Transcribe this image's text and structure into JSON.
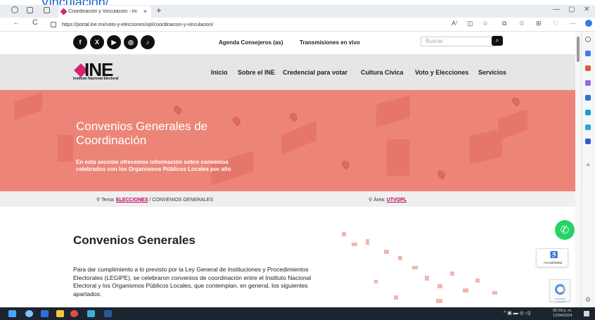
{
  "stray_link": "Vinculacion/",
  "browser": {
    "tab_title": "Coordinación y Vinculación - Inst",
    "tab_close": "×",
    "new_tab": "+",
    "url": "https://portal.ine.mx/voto-y-elecciones/opl/coordinacion-y-vinculacion/",
    "minimize": "—",
    "restore": "▢",
    "close": "✕",
    "back": "←",
    "reload": "C",
    "more": "···"
  },
  "site": {
    "socials": [
      {
        "icon": "facebook-icon",
        "glyph": "f"
      },
      {
        "icon": "x-twitter-icon",
        "glyph": "X"
      },
      {
        "icon": "youtube-icon",
        "glyph": "▶"
      },
      {
        "icon": "instagram-icon",
        "glyph": "◎"
      },
      {
        "icon": "tiktok-icon",
        "glyph": "♪"
      }
    ],
    "top_links": [
      "Agenda Consejeros (as)",
      "Transmisiones en vivo"
    ],
    "search_placeholder": "Buscar",
    "logo_text": "INE",
    "logo_sub": "Instituto Nacional Electoral",
    "nav": [
      "Inicio",
      "Sobre el INE",
      "Credencial para votar",
      "Cultura Cívica",
      "Voto y Elecciones",
      "Servicios"
    ]
  },
  "hero": {
    "title": "Convenios Generales de Coordinación",
    "description": "En esta sección ofrecemos información sobre convenios celebrados con los Organismos Públicos Locales por año"
  },
  "breadcrumb": {
    "tema_label": "Tema:",
    "tema_link": "ELECCIONES",
    "tema_rest": "/ CONVENIOS GENERALES",
    "area_label": "Área:",
    "area_link": "UTVOPL"
  },
  "content": {
    "heading": "Convenios Generales",
    "paragraph": "Para dar cumplimiento a lo previsto por la Ley General de Instituciones y Procedimientos Electorales (LEGIPE), se celebraron convenios de coordinación entre el Instituto Nacional Electoral y los Organismos Públicos Locales, que contemplan, en general, los siguientes apartados:"
  },
  "widgets": {
    "accessibility_label": "Accesibilidad",
    "recaptcha_label": "Privacidad - Términos"
  },
  "taskbar": {
    "time": "05:39 p. m.",
    "date": "12/04/2024"
  },
  "colors": {
    "brand": "#d6226f",
    "hero": "#ec8578",
    "whatsapp": "#25d366",
    "taskbar": "#1c2430"
  }
}
